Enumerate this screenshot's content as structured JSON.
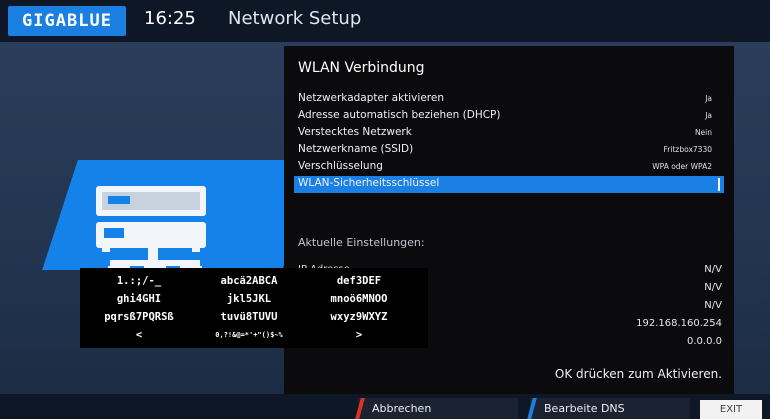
{
  "header": {
    "logo_text": "GIGABLUE",
    "time": "16:25",
    "title": "Network Setup"
  },
  "dialog": {
    "title": "WLAN Verbindung",
    "settings": [
      {
        "label": "Netzwerkadapter aktivieren",
        "value": "Ja"
      },
      {
        "label": "Adresse automatisch beziehen (DHCP)",
        "value": "Ja"
      },
      {
        "label": "Verstecktes Netzwerk",
        "value": "Nein"
      },
      {
        "label": "Netzwerkname (SSID)",
        "value": "Fritzbox7330"
      },
      {
        "label": "Verschlüsselung",
        "value": "WPA oder WPA2"
      },
      {
        "label": "WLAN-Sicherheitsschlüssel",
        "value": ""
      }
    ],
    "section_title": "Aktuelle Einstellungen:",
    "info_label": "IP-Adresse",
    "info_values": [
      "N/V",
      "N/V",
      "N/V",
      "192.168.160.254",
      "0.0.0.0"
    ],
    "ok_text": "OK drücken zum Aktivieren."
  },
  "keyboard": {
    "keys": [
      [
        "1.:;/-_",
        "abcä2ABCA",
        "def3DEF"
      ],
      [
        "ghi4GHI",
        "jkl5JKL",
        "mnoö6MNOO"
      ],
      [
        "pqrsß7PQRSß",
        "tuvü8TUVU",
        "wxyz9WXYZ"
      ],
      [
        "<",
        "0,?!&@=*'+\"()$~%",
        ">"
      ]
    ]
  },
  "footer": {
    "cancel_label": "Abbrechen",
    "dns_label": "Bearbeite DNS",
    "exit_label": "EXIT"
  },
  "colors": {
    "accent": "#1a80e6",
    "cancel_red": "#e0301e",
    "dns_blue": "#1a7fe0"
  }
}
